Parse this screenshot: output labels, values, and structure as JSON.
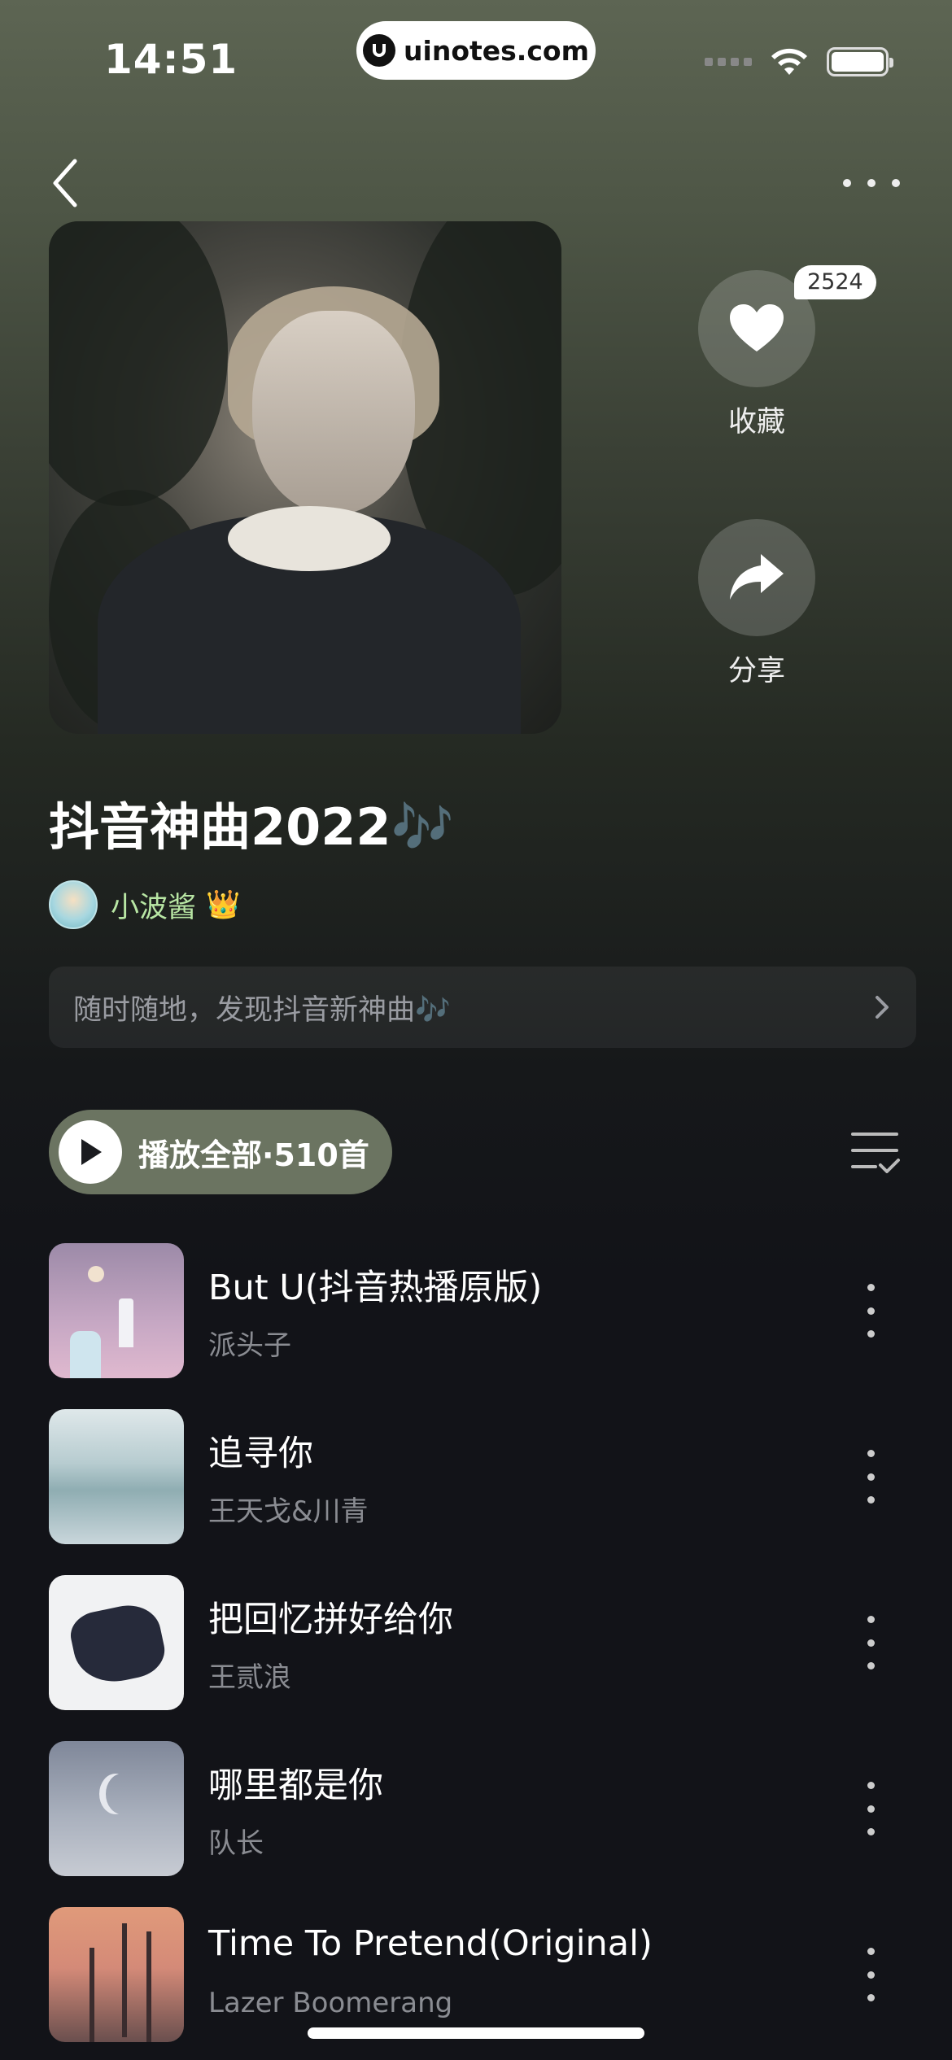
{
  "status_bar": {
    "time": "14:51",
    "url": "uinotes.com",
    "icons": [
      "signal-icon",
      "wifi-icon",
      "battery-icon"
    ]
  },
  "nav": {
    "back_icon": "chevron-left-icon",
    "more_icon": "more-horizontal-icon"
  },
  "actions": {
    "favorite": {
      "label": "收藏",
      "count": "2524",
      "icon": "heart-icon"
    },
    "share": {
      "label": "分享",
      "icon": "share-arrow-icon"
    }
  },
  "playlist": {
    "title": "抖音神曲2022🎶",
    "creator": "小波酱",
    "creator_badge": "👑",
    "description": "随时随地，发现抖音新神曲🎶"
  },
  "play_all": {
    "label": "播放全部·510首"
  },
  "songs": [
    {
      "title": "But U(抖音热播原版)",
      "artist": "派头子"
    },
    {
      "title": "追寻你",
      "artist": "王天戈&川青"
    },
    {
      "title": "把回忆拼好给你",
      "artist": "王贰浪"
    },
    {
      "title": "哪里都是你",
      "artist": "队长"
    },
    {
      "title": "Time To Pretend(Original)",
      "artist": "Lazer Boomerang"
    }
  ],
  "colors": {
    "play_all_bg": "#6b7461",
    "creator_name": "#b8e6a4",
    "background": "#121318"
  }
}
